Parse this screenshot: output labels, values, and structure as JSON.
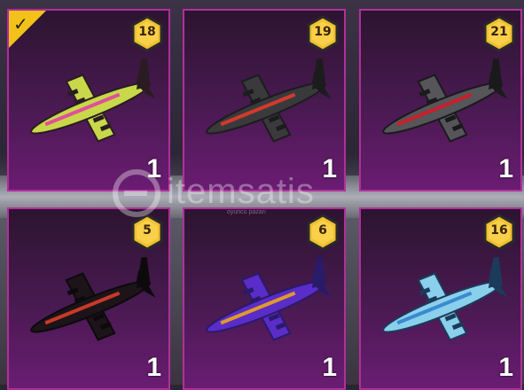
{
  "items": [
    {
      "level": "18",
      "count": "1",
      "selected": true,
      "colors": {
        "body": "#c8d84a",
        "accent": "#e0509a",
        "dark": "#2a1c22"
      }
    },
    {
      "level": "19",
      "count": "1",
      "selected": false,
      "colors": {
        "body": "#3a3a3c",
        "accent": "#d23a2c",
        "dark": "#1c1c1e"
      }
    },
    {
      "level": "21",
      "count": "1",
      "selected": false,
      "colors": {
        "body": "#55555a",
        "accent": "#c8202a",
        "dark": "#1a1a1c"
      }
    },
    {
      "level": "5",
      "count": "1",
      "selected": false,
      "colors": {
        "body": "#1c1418",
        "accent": "#c83a28",
        "dark": "#0c0a0c"
      }
    },
    {
      "level": "6",
      "count": "1",
      "selected": false,
      "colors": {
        "body": "#5a2cc8",
        "accent": "#e09a2a",
        "dark": "#2a1a6a"
      }
    },
    {
      "level": "16",
      "count": "1",
      "selected": false,
      "colors": {
        "body": "#8ad0ec",
        "accent": "#3a8ad0",
        "dark": "#1c3a5a"
      }
    }
  ],
  "watermark": {
    "text": "itemsatis",
    "subtext": "oyuncu pazarı"
  },
  "theme": {
    "card_border": "#b0309a",
    "badge_gold": "#f0c030",
    "check_yellow": "#f2c21a"
  }
}
